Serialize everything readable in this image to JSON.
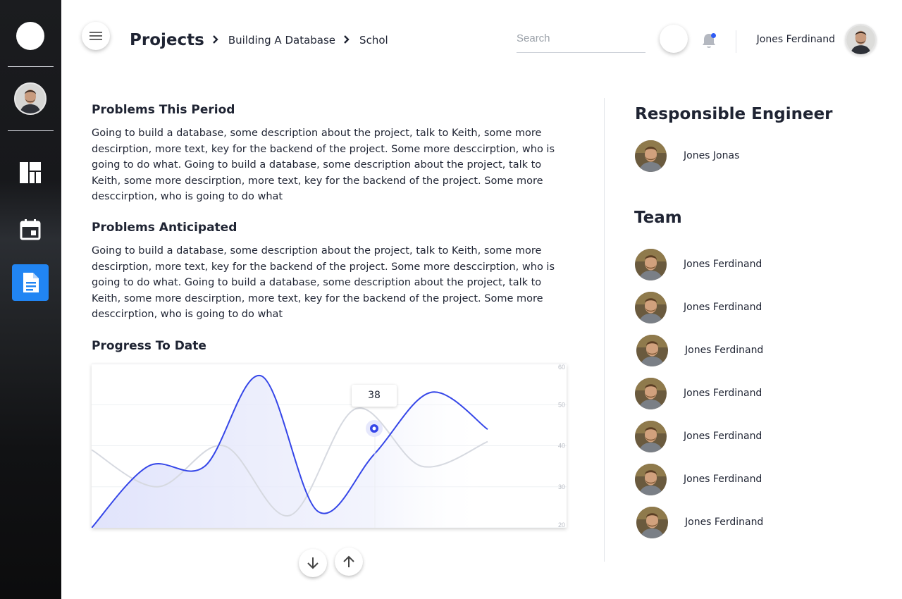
{
  "header": {
    "breadcrumb": [
      "Projects",
      "Building A Database",
      "Schol"
    ],
    "search_placeholder": "Search",
    "user_name": "Jones Ferdinand"
  },
  "sections": [
    {
      "title": "Problems This Period",
      "body": "Going to build a database, some description about the project, talk to Keith, some more descirption, more text, key for the backend of the project. Some more desccirption, who is going to do what. Going to build a database, some description about the project, talk to Keith, some more descirption, more text, key for the backend of the project. Some more desccirption, who is going to do what"
    },
    {
      "title": "Problems Anticipated",
      "body": "Going to build a database, some description about the project, talk to Keith, some more descirption, more text, key for the backend of the project. Some more desccirption, who is going to do what. Going to build a database, some description about the project, talk to Keith, some more descirption, more text, key for the backend of the project. Some more desccirption, who is going to do what"
    }
  ],
  "progress_title": "Progress To Date",
  "chart_data": {
    "type": "area",
    "ylim": [
      20,
      60
    ],
    "y_ticks": [
      "60",
      "50",
      "40",
      "30",
      "20"
    ],
    "tooltip_value": "38",
    "series": [
      {
        "color": "#3546e8",
        "values": [
          20,
          35,
          35,
          57,
          24,
          38,
          53,
          44
        ]
      },
      {
        "color": "#d6d9e0",
        "values": [
          39,
          30,
          40,
          23,
          49,
          35,
          41
        ]
      }
    ]
  },
  "responsible": {
    "heading": "Responsible Engineer",
    "name": "Jones Jonas"
  },
  "team": {
    "heading": "Team",
    "members": [
      "Jones Ferdinand",
      "Jones Ferdinand",
      "Jones Ferdinand",
      "Jones Ferdinand",
      "Jones Ferdinand",
      "Jones Ferdinand",
      "Jones Ferdinand"
    ]
  },
  "colors": {
    "accent": "#2185f3",
    "line": "#3546e8",
    "notification_dot": "#2f5cf5"
  },
  "icons": {
    "sidebar": [
      "dashboard-icon",
      "calendar-icon",
      "document-icon"
    ],
    "header": [
      "menu-icon",
      "bell-icon"
    ],
    "chart_nav": [
      "arrow-down-icon",
      "arrow-up-icon"
    ]
  }
}
